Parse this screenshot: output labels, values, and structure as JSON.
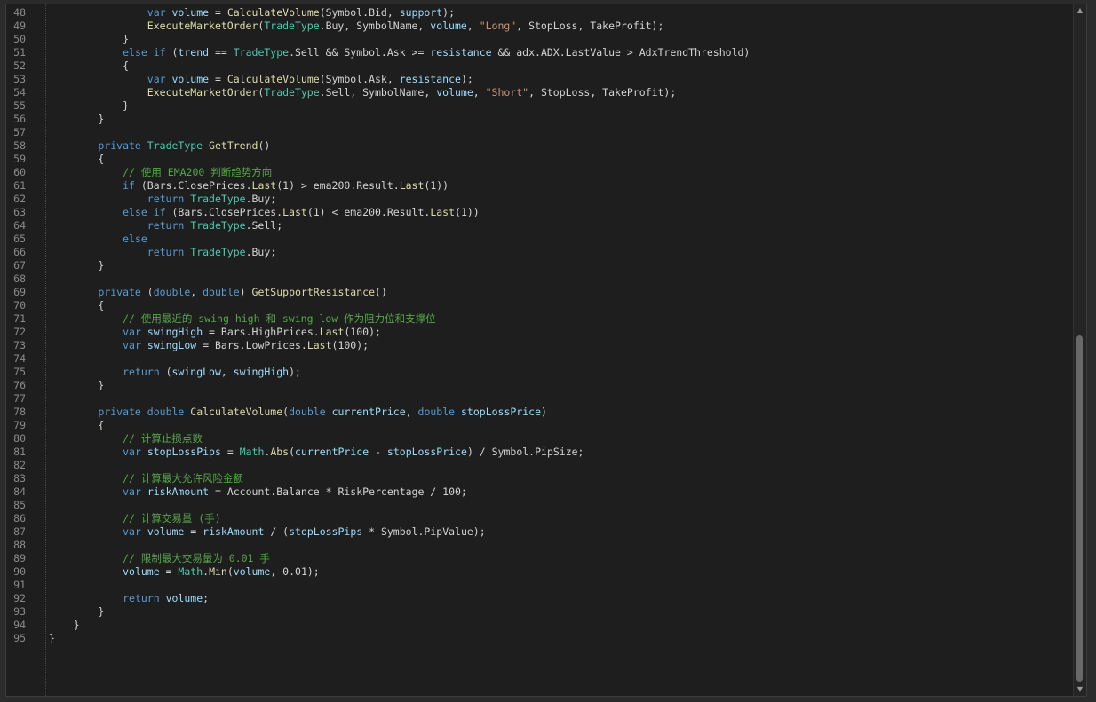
{
  "editor": {
    "lines": [
      {
        "n": "48",
        "tokens": [
          {
            "t": "                ",
            "c": "plain"
          },
          {
            "t": "var",
            "c": "kw"
          },
          {
            "t": " ",
            "c": "plain"
          },
          {
            "t": "volume",
            "c": "var"
          },
          {
            "t": " = ",
            "c": "plain"
          },
          {
            "t": "CalculateVolume",
            "c": "method"
          },
          {
            "t": "(Symbol.Bid, ",
            "c": "plain"
          },
          {
            "t": "support",
            "c": "var"
          },
          {
            "t": ");",
            "c": "plain"
          }
        ]
      },
      {
        "n": "49",
        "tokens": [
          {
            "t": "                ",
            "c": "plain"
          },
          {
            "t": "ExecuteMarketOrder",
            "c": "method"
          },
          {
            "t": "(",
            "c": "plain"
          },
          {
            "t": "TradeType",
            "c": "type"
          },
          {
            "t": ".Buy, SymbolName, ",
            "c": "plain"
          },
          {
            "t": "volume",
            "c": "var"
          },
          {
            "t": ", ",
            "c": "plain"
          },
          {
            "t": "\"Long\"",
            "c": "str"
          },
          {
            "t": ", StopLoss, TakeProfit);",
            "c": "plain"
          }
        ]
      },
      {
        "n": "50",
        "tokens": [
          {
            "t": "            }",
            "c": "plain"
          }
        ]
      },
      {
        "n": "51",
        "tokens": [
          {
            "t": "            ",
            "c": "plain"
          },
          {
            "t": "else if",
            "c": "kw"
          },
          {
            "t": " (",
            "c": "plain"
          },
          {
            "t": "trend",
            "c": "var"
          },
          {
            "t": " == ",
            "c": "plain"
          },
          {
            "t": "TradeType",
            "c": "type"
          },
          {
            "t": ".Sell && Symbol.Ask >= ",
            "c": "plain"
          },
          {
            "t": "resistance",
            "c": "var"
          },
          {
            "t": " && adx.ADX.LastValue > AdxTrendThreshold)",
            "c": "plain"
          }
        ]
      },
      {
        "n": "52",
        "tokens": [
          {
            "t": "            {",
            "c": "plain"
          }
        ]
      },
      {
        "n": "53",
        "tokens": [
          {
            "t": "                ",
            "c": "plain"
          },
          {
            "t": "var",
            "c": "kw"
          },
          {
            "t": " ",
            "c": "plain"
          },
          {
            "t": "volume",
            "c": "var"
          },
          {
            "t": " = ",
            "c": "plain"
          },
          {
            "t": "CalculateVolume",
            "c": "method"
          },
          {
            "t": "(Symbol.Ask, ",
            "c": "plain"
          },
          {
            "t": "resistance",
            "c": "var"
          },
          {
            "t": ");",
            "c": "plain"
          }
        ]
      },
      {
        "n": "54",
        "tokens": [
          {
            "t": "                ",
            "c": "plain"
          },
          {
            "t": "ExecuteMarketOrder",
            "c": "method"
          },
          {
            "t": "(",
            "c": "plain"
          },
          {
            "t": "TradeType",
            "c": "type"
          },
          {
            "t": ".Sell, SymbolName, ",
            "c": "plain"
          },
          {
            "t": "volume",
            "c": "var"
          },
          {
            "t": ", ",
            "c": "plain"
          },
          {
            "t": "\"Short\"",
            "c": "str"
          },
          {
            "t": ", StopLoss, TakeProfit);",
            "c": "plain"
          }
        ]
      },
      {
        "n": "55",
        "tokens": [
          {
            "t": "            }",
            "c": "plain"
          }
        ]
      },
      {
        "n": "56",
        "tokens": [
          {
            "t": "        }",
            "c": "plain"
          }
        ]
      },
      {
        "n": "57",
        "tokens": []
      },
      {
        "n": "58",
        "tokens": [
          {
            "t": "        ",
            "c": "plain"
          },
          {
            "t": "private",
            "c": "kw"
          },
          {
            "t": " ",
            "c": "plain"
          },
          {
            "t": "TradeType",
            "c": "type"
          },
          {
            "t": " ",
            "c": "plain"
          },
          {
            "t": "GetTrend",
            "c": "method"
          },
          {
            "t": "()",
            "c": "plain"
          }
        ]
      },
      {
        "n": "59",
        "tokens": [
          {
            "t": "        {",
            "c": "plain"
          }
        ]
      },
      {
        "n": "60",
        "tokens": [
          {
            "t": "            ",
            "c": "plain"
          },
          {
            "t": "// 使用 EMA200 判断趋势方向",
            "c": "comment"
          }
        ]
      },
      {
        "n": "61",
        "tokens": [
          {
            "t": "            ",
            "c": "plain"
          },
          {
            "t": "if",
            "c": "kw"
          },
          {
            "t": " (Bars.ClosePrices.",
            "c": "plain"
          },
          {
            "t": "Last",
            "c": "method"
          },
          {
            "t": "(1) > ema200.Result.",
            "c": "plain"
          },
          {
            "t": "Last",
            "c": "method"
          },
          {
            "t": "(1))",
            "c": "plain"
          }
        ]
      },
      {
        "n": "62",
        "tokens": [
          {
            "t": "                ",
            "c": "plain"
          },
          {
            "t": "return",
            "c": "kw"
          },
          {
            "t": " ",
            "c": "plain"
          },
          {
            "t": "TradeType",
            "c": "type"
          },
          {
            "t": ".Buy;",
            "c": "plain"
          }
        ]
      },
      {
        "n": "63",
        "tokens": [
          {
            "t": "            ",
            "c": "plain"
          },
          {
            "t": "else if",
            "c": "kw"
          },
          {
            "t": " (Bars.ClosePrices.",
            "c": "plain"
          },
          {
            "t": "Last",
            "c": "method"
          },
          {
            "t": "(1) < ema200.Result.",
            "c": "plain"
          },
          {
            "t": "Last",
            "c": "method"
          },
          {
            "t": "(1))",
            "c": "plain"
          }
        ]
      },
      {
        "n": "64",
        "tokens": [
          {
            "t": "                ",
            "c": "plain"
          },
          {
            "t": "return",
            "c": "kw"
          },
          {
            "t": " ",
            "c": "plain"
          },
          {
            "t": "TradeType",
            "c": "type"
          },
          {
            "t": ".Sell;",
            "c": "plain"
          }
        ]
      },
      {
        "n": "65",
        "tokens": [
          {
            "t": "            ",
            "c": "plain"
          },
          {
            "t": "else",
            "c": "kw"
          }
        ]
      },
      {
        "n": "66",
        "tokens": [
          {
            "t": "                ",
            "c": "plain"
          },
          {
            "t": "return",
            "c": "kw"
          },
          {
            "t": " ",
            "c": "plain"
          },
          {
            "t": "TradeType",
            "c": "type"
          },
          {
            "t": ".Buy;",
            "c": "plain"
          }
        ]
      },
      {
        "n": "67",
        "tokens": [
          {
            "t": "        }",
            "c": "plain"
          }
        ]
      },
      {
        "n": "68",
        "tokens": []
      },
      {
        "n": "69",
        "tokens": [
          {
            "t": "        ",
            "c": "plain"
          },
          {
            "t": "private",
            "c": "kw"
          },
          {
            "t": " (",
            "c": "plain"
          },
          {
            "t": "double",
            "c": "kw"
          },
          {
            "t": ", ",
            "c": "plain"
          },
          {
            "t": "double",
            "c": "kw"
          },
          {
            "t": ") ",
            "c": "plain"
          },
          {
            "t": "GetSupportResistance",
            "c": "method"
          },
          {
            "t": "()",
            "c": "plain"
          }
        ]
      },
      {
        "n": "70",
        "tokens": [
          {
            "t": "        {",
            "c": "plain"
          }
        ]
      },
      {
        "n": "71",
        "tokens": [
          {
            "t": "            ",
            "c": "plain"
          },
          {
            "t": "// 使用最近的 swing high 和 swing low 作为阻力位和支撑位",
            "c": "comment"
          }
        ]
      },
      {
        "n": "72",
        "tokens": [
          {
            "t": "            ",
            "c": "plain"
          },
          {
            "t": "var",
            "c": "kw"
          },
          {
            "t": " ",
            "c": "plain"
          },
          {
            "t": "swingHigh",
            "c": "var"
          },
          {
            "t": " = Bars.HighPrices.",
            "c": "plain"
          },
          {
            "t": "Last",
            "c": "method"
          },
          {
            "t": "(100);",
            "c": "plain"
          }
        ]
      },
      {
        "n": "73",
        "tokens": [
          {
            "t": "            ",
            "c": "plain"
          },
          {
            "t": "var",
            "c": "kw"
          },
          {
            "t": " ",
            "c": "plain"
          },
          {
            "t": "swingLow",
            "c": "var"
          },
          {
            "t": " = Bars.LowPrices.",
            "c": "plain"
          },
          {
            "t": "Last",
            "c": "method"
          },
          {
            "t": "(100);",
            "c": "plain"
          }
        ]
      },
      {
        "n": "74",
        "tokens": []
      },
      {
        "n": "75",
        "tokens": [
          {
            "t": "            ",
            "c": "plain"
          },
          {
            "t": "return",
            "c": "kw"
          },
          {
            "t": " (",
            "c": "plain"
          },
          {
            "t": "swingLow",
            "c": "var"
          },
          {
            "t": ", ",
            "c": "plain"
          },
          {
            "t": "swingHigh",
            "c": "var"
          },
          {
            "t": ");",
            "c": "plain"
          }
        ]
      },
      {
        "n": "76",
        "tokens": [
          {
            "t": "        }",
            "c": "plain"
          }
        ]
      },
      {
        "n": "77",
        "tokens": []
      },
      {
        "n": "78",
        "tokens": [
          {
            "t": "        ",
            "c": "plain"
          },
          {
            "t": "private",
            "c": "kw"
          },
          {
            "t": " ",
            "c": "plain"
          },
          {
            "t": "double",
            "c": "kw"
          },
          {
            "t": " ",
            "c": "plain"
          },
          {
            "t": "CalculateVolume",
            "c": "method"
          },
          {
            "t": "(",
            "c": "plain"
          },
          {
            "t": "double",
            "c": "kw"
          },
          {
            "t": " ",
            "c": "plain"
          },
          {
            "t": "currentPrice",
            "c": "var"
          },
          {
            "t": ", ",
            "c": "plain"
          },
          {
            "t": "double",
            "c": "kw"
          },
          {
            "t": " ",
            "c": "plain"
          },
          {
            "t": "stopLossPrice",
            "c": "var"
          },
          {
            "t": ")",
            "c": "plain"
          }
        ]
      },
      {
        "n": "79",
        "tokens": [
          {
            "t": "        {",
            "c": "plain"
          }
        ]
      },
      {
        "n": "80",
        "tokens": [
          {
            "t": "            ",
            "c": "plain"
          },
          {
            "t": "// 计算止损点数",
            "c": "comment"
          }
        ]
      },
      {
        "n": "81",
        "tokens": [
          {
            "t": "            ",
            "c": "plain"
          },
          {
            "t": "var",
            "c": "kw"
          },
          {
            "t": " ",
            "c": "plain"
          },
          {
            "t": "stopLossPips",
            "c": "var"
          },
          {
            "t": " = ",
            "c": "plain"
          },
          {
            "t": "Math",
            "c": "type"
          },
          {
            "t": ".",
            "c": "plain"
          },
          {
            "t": "Abs",
            "c": "method"
          },
          {
            "t": "(",
            "c": "plain"
          },
          {
            "t": "currentPrice",
            "c": "var"
          },
          {
            "t": " - ",
            "c": "plain"
          },
          {
            "t": "stopLossPrice",
            "c": "var"
          },
          {
            "t": ") / Symbol.PipSize;",
            "c": "plain"
          }
        ]
      },
      {
        "n": "82",
        "tokens": []
      },
      {
        "n": "83",
        "tokens": [
          {
            "t": "            ",
            "c": "plain"
          },
          {
            "t": "// 计算最大允许风险金额",
            "c": "comment"
          }
        ]
      },
      {
        "n": "84",
        "tokens": [
          {
            "t": "            ",
            "c": "plain"
          },
          {
            "t": "var",
            "c": "kw"
          },
          {
            "t": " ",
            "c": "plain"
          },
          {
            "t": "riskAmount",
            "c": "var"
          },
          {
            "t": " = Account.Balance * RiskPercentage / 100;",
            "c": "plain"
          }
        ]
      },
      {
        "n": "85",
        "tokens": []
      },
      {
        "n": "86",
        "tokens": [
          {
            "t": "            ",
            "c": "plain"
          },
          {
            "t": "// 计算交易量 (手)",
            "c": "comment"
          }
        ]
      },
      {
        "n": "87",
        "tokens": [
          {
            "t": "            ",
            "c": "plain"
          },
          {
            "t": "var",
            "c": "kw"
          },
          {
            "t": " ",
            "c": "plain"
          },
          {
            "t": "volume",
            "c": "var"
          },
          {
            "t": " = ",
            "c": "plain"
          },
          {
            "t": "riskAmount",
            "c": "var"
          },
          {
            "t": " / (",
            "c": "plain"
          },
          {
            "t": "stopLossPips",
            "c": "var"
          },
          {
            "t": " * Symbol.PipValue);",
            "c": "plain"
          }
        ]
      },
      {
        "n": "88",
        "tokens": []
      },
      {
        "n": "89",
        "tokens": [
          {
            "t": "            ",
            "c": "plain"
          },
          {
            "t": "// 限制最大交易量为 0.01 手",
            "c": "comment"
          }
        ]
      },
      {
        "n": "90",
        "tokens": [
          {
            "t": "            ",
            "c": "plain"
          },
          {
            "t": "volume",
            "c": "var"
          },
          {
            "t": " = ",
            "c": "plain"
          },
          {
            "t": "Math",
            "c": "type"
          },
          {
            "t": ".",
            "c": "plain"
          },
          {
            "t": "Min",
            "c": "method"
          },
          {
            "t": "(",
            "c": "plain"
          },
          {
            "t": "volume",
            "c": "var"
          },
          {
            "t": ", 0.01);",
            "c": "plain"
          }
        ]
      },
      {
        "n": "91",
        "tokens": []
      },
      {
        "n": "92",
        "tokens": [
          {
            "t": "            ",
            "c": "plain"
          },
          {
            "t": "return",
            "c": "kw"
          },
          {
            "t": " ",
            "c": "plain"
          },
          {
            "t": "volume",
            "c": "var"
          },
          {
            "t": ";",
            "c": "plain"
          }
        ]
      },
      {
        "n": "93",
        "tokens": [
          {
            "t": "        }",
            "c": "plain"
          }
        ]
      },
      {
        "n": "94",
        "tokens": [
          {
            "t": "    }",
            "c": "plain"
          }
        ]
      },
      {
        "n": "95",
        "tokens": [
          {
            "t": "}",
            "c": "plain"
          }
        ]
      }
    ]
  },
  "scrollbar": {
    "up_icon": "triangle-up-icon",
    "down_icon": "triangle-down-icon",
    "up_glyph": "▲",
    "down_glyph": "▼",
    "position_fraction": 0.48
  },
  "colors": {
    "keyword": "#569cd6",
    "type": "#4ec9b0",
    "method": "#dcdcaa",
    "variable": "#9cdcfe",
    "string": "#ce9178",
    "comment": "#57a64a",
    "background": "#1e1e1e"
  }
}
